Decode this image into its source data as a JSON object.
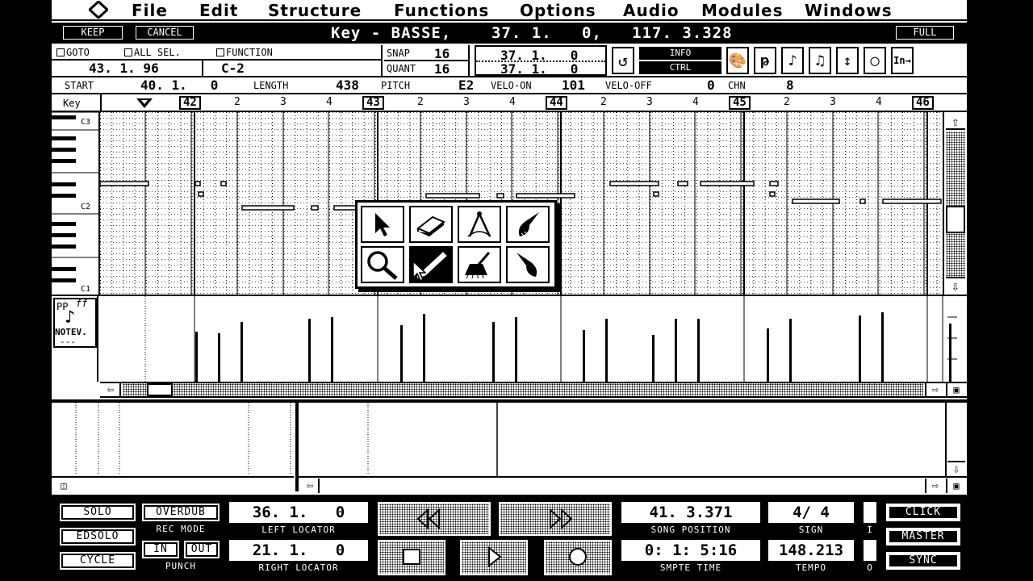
{
  "menubar": {
    "logo_icon": "diamond-logo-icon",
    "items": [
      "File",
      "Edit",
      "Structure",
      "Functions",
      "Options",
      "Audio",
      "Modules",
      "Windows"
    ]
  },
  "titlebar": {
    "keep": "KEEP",
    "cancel": "CANCEL",
    "title": "Key - BASSE,    37. 1.   0,   117. 3.328",
    "full": "FULL"
  },
  "info": {
    "goto": "GOTO",
    "all_sel": "ALL SEL.",
    "function": "FUNCTION",
    "position": "43. 1. 96",
    "note": "C-2",
    "snap_label": "SNAP",
    "snap_value": "16",
    "quant_label": "QUANT",
    "quant_value": "16",
    "mouse_pos_1": "37. 1.   0",
    "mouse_pos_2": "37. 1.   0",
    "info_label": "INFO",
    "ctrl_label": "CTRL"
  },
  "event": {
    "start_label": "START",
    "start": "40. 1.   0",
    "length_label": "LENGTH",
    "length": "438",
    "pitch_label": "PITCH",
    "pitch": "E2",
    "velo_on_label": "VELO-ON",
    "velo_on": "101",
    "velo_off_label": "VELO-OFF",
    "velo_off": "0",
    "chn_label": "CHN",
    "chn": "8"
  },
  "ruler": {
    "key_label": "Key",
    "bars": [
      "42",
      "43",
      "44",
      "45",
      "46"
    ],
    "beats": [
      "2",
      "3",
      "4"
    ]
  },
  "keyboard": {
    "labels": [
      "C3",
      "C2",
      "C1"
    ]
  },
  "toolbox": {
    "tools": [
      "arrow-icon",
      "eraser-icon",
      "compass-icon",
      "brush-icon",
      "magnifier-icon",
      "pencil-icon",
      "broom-icon",
      "paint-icon"
    ],
    "selected": 5
  },
  "velocity": {
    "panel_label_1": "PP",
    "panel_label_2": "ff",
    "panel_label_3": "NOTEV.",
    "panel_label_4": "---"
  },
  "transport": {
    "solo": "SOLO",
    "edsolo": "EDSOLO",
    "cycle": "CYCLE",
    "overdub": "OVERDUB",
    "rec_mode": "REC MODE",
    "in": "IN",
    "out": "OUT",
    "punch": "PUNCH",
    "left_locator_value": "36. 1.   0",
    "left_locator": "LEFT LOCATOR",
    "right_locator_value": "21. 1.   0",
    "right_locator": "RIGHT LOCATOR",
    "song_position_value": "41. 3.371",
    "song_position": "SONG POSITION",
    "smpte_value": "0: 1: 5:16",
    "smpte": "SMPTE TIME",
    "sign_value": "4/ 4",
    "sign": "SIGN",
    "tempo_value": "148.213",
    "tempo": "TEMPO",
    "i_label": "I",
    "o_label": "O",
    "click": "CLICK",
    "master": "MASTER",
    "sync": "SYNC"
  }
}
